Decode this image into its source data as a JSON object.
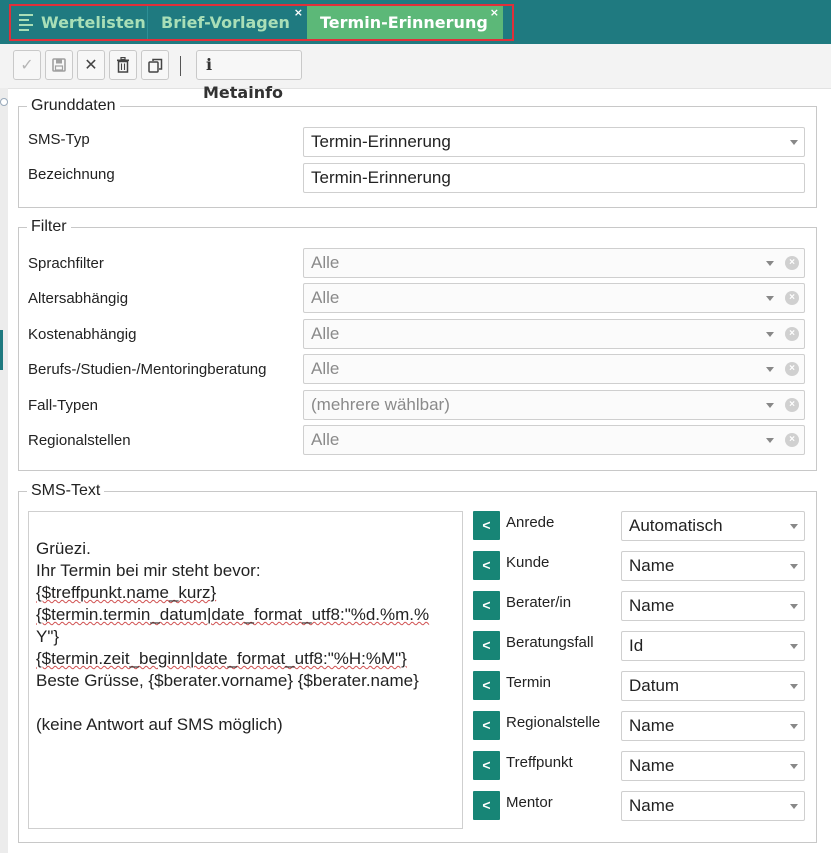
{
  "tabs": [
    {
      "label": "Wertelisten",
      "icon": "menu-icon"
    },
    {
      "label": "Brief-Vorlagen",
      "close": "×"
    },
    {
      "label": "Termin-Erinnerung",
      "close": "×"
    }
  ],
  "toolbar": {
    "save_check": "✓",
    "save_disk": "💾",
    "cancel": "✕",
    "delete": "🗑",
    "copy": "⧉",
    "meta_icon": "i",
    "meta_label": "Metainfo"
  },
  "grunddaten": {
    "legend": "Grunddaten",
    "sms_typ_label": "SMS-Typ",
    "sms_typ_value": "Termin-Erinnerung",
    "bezeichnung_label": "Bezeichnung",
    "bezeichnung_value": "Termin-Erinnerung"
  },
  "filter": {
    "legend": "Filter",
    "rows": [
      {
        "label": "Sprachfilter",
        "value": "Alle"
      },
      {
        "label": "Altersabhängig",
        "value": "Alle"
      },
      {
        "label": "Kostenabhängig",
        "value": "Alle"
      },
      {
        "label": "Berufs-/Studien-/Mentoringberatung",
        "value": "Alle"
      },
      {
        "label": "Fall-Typen",
        "value": "(mehrere wählbar)"
      },
      {
        "label": "Regionalstellen",
        "value": "Alle"
      }
    ],
    "clear_glyph": "×"
  },
  "sms_text": {
    "legend": "SMS-Text",
    "lines": [
      "Grüezi.",
      "Ihr Termin bei mir steht bevor:",
      "{$treffpunkt.name_kurz}",
      "{$termin.termin_datum|date_format_utf8:\"%d.%m.%",
      "Y\"}",
      "{$termin.zeit_beginn|date_format_utf8:\"%H:%M\"}",
      "Beste Grüsse, {$berater.vorname} {$berater.name}",
      "",
      "(keine Antwort auf SMS möglich)"
    ],
    "insert_glyph": "<",
    "variables": [
      {
        "label": "Anrede",
        "value": "Automatisch"
      },
      {
        "label": "Kunde",
        "value": "Name"
      },
      {
        "label": "Berater/in",
        "value": "Name"
      },
      {
        "label": "Beratungsfall",
        "value": "Id"
      },
      {
        "label": "Termin",
        "value": "Datum"
      },
      {
        "label": "Regionalstelle",
        "value": "Name"
      },
      {
        "label": "Treffpunkt",
        "value": "Name"
      },
      {
        "label": "Mentor",
        "value": "Name"
      }
    ]
  },
  "colors": {
    "topbar": "#1f7a80",
    "active_tab": "#5cb878",
    "insert_button": "#178576",
    "highlight": "#e0303a"
  }
}
